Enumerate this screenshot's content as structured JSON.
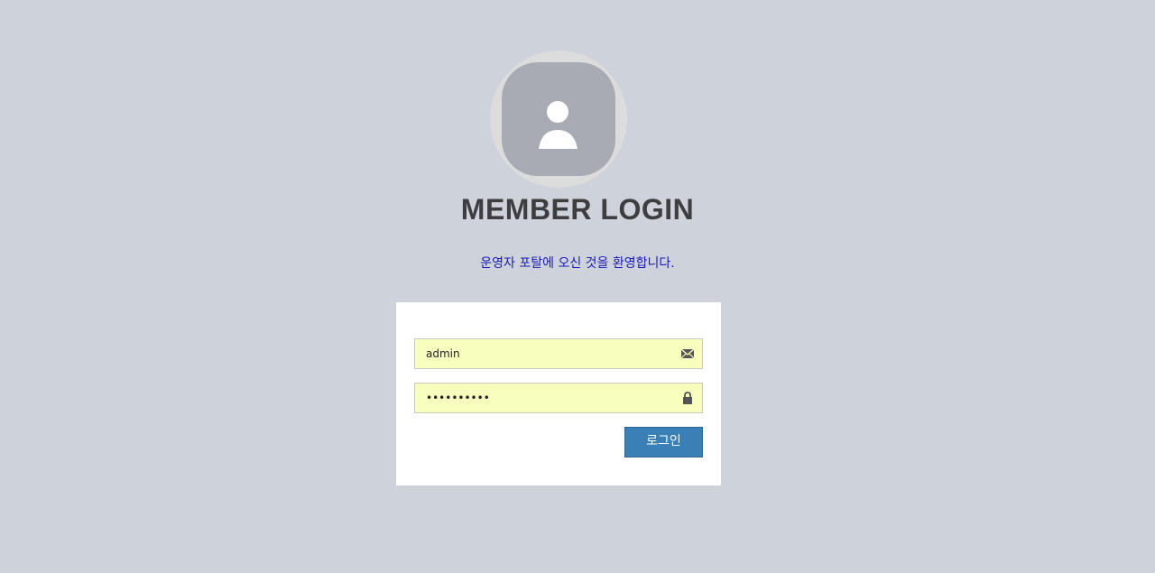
{
  "header": {
    "avatar_icon": "user-icon",
    "title": "MEMBER LOGIN",
    "subtitle": "운영자 포탈에 오신 것을 환영합니다."
  },
  "form": {
    "username": {
      "value": "admin",
      "icon": "envelope-icon"
    },
    "password": {
      "value": "••••••••••",
      "icon": "lock-icon"
    },
    "login_label": "로그인"
  },
  "colors": {
    "background": "#ced2db",
    "accent": "#3a7fb5",
    "subtitle": "#1a1ab5",
    "input_autofill": "#f8ffbe"
  }
}
